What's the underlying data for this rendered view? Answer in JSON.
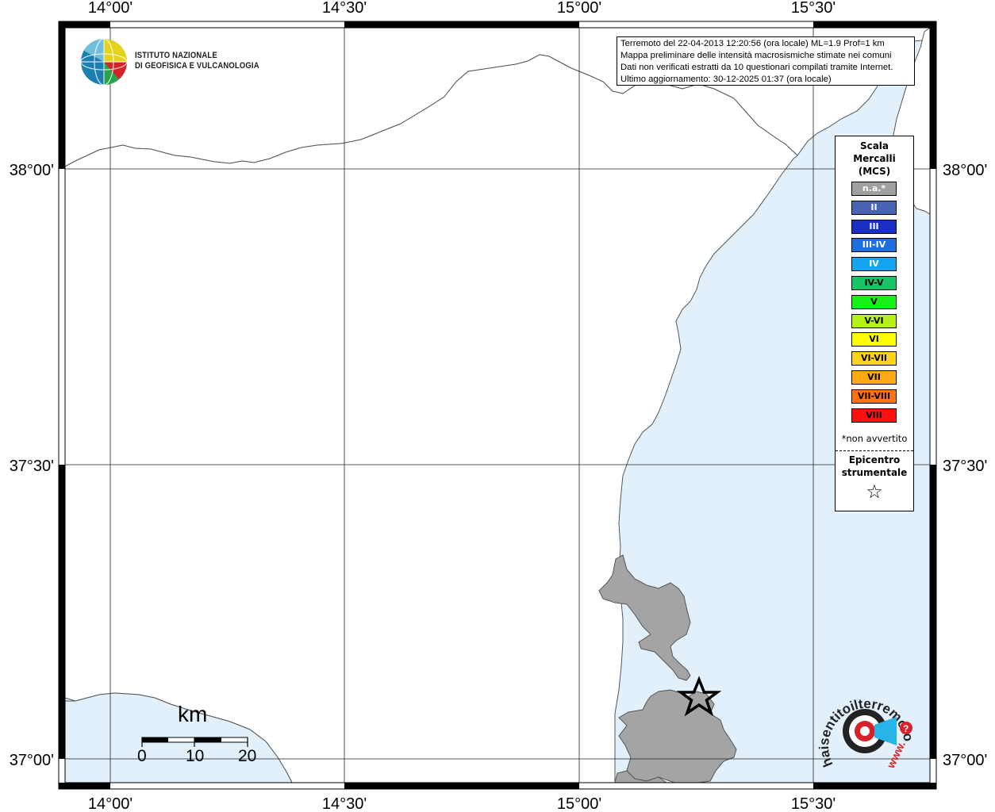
{
  "map": {
    "colors": {
      "sea": "#e1f0fb",
      "land": "#ffffff",
      "island": "#a4a4a4",
      "frame": "#000000"
    },
    "lon_ticks": [
      "14°00'",
      "14°30'",
      "15°00'",
      "15°30'"
    ],
    "lat_ticks": [
      "38°00'",
      "37°30'",
      "37°00'"
    ]
  },
  "info": {
    "line1": "Terremoto del 22-04-2013 12:20:56 (ora locale) ML=1.9 Prof=1 km",
    "line2": "Mappa preliminare delle intensità macrosismiche stimate nei comuni",
    "line3": "Dati non verificati estratti da 10 questionari compilati tramite Internet.",
    "line4": "Ultimo aggiornamento: 30-12-2025 01:37 (ora locale)"
  },
  "logo": {
    "line1": "ISTITUTO NAZIONALE",
    "line2": "DI GEOFISICA E VULCANOLOGIA"
  },
  "legend": {
    "title1": "Scala",
    "title2": "Mercalli",
    "title3": "(MCS)",
    "items": [
      {
        "label": "n.a.*",
        "color": "#a0a0a0"
      },
      {
        "label": "II",
        "color": "#4a64b4"
      },
      {
        "label": "III",
        "color": "#1a2ec4"
      },
      {
        "label": "III-IV",
        "color": "#1e6ede"
      },
      {
        "label": "IV",
        "color": "#14a4f0"
      },
      {
        "label": "IV-V",
        "color": "#18c464"
      },
      {
        "label": "V",
        "color": "#18f018"
      },
      {
        "label": "V-VI",
        "color": "#b4f01a"
      },
      {
        "label": "VI",
        "color": "#ffff00"
      },
      {
        "label": "VI-VII",
        "color": "#ffd21e"
      },
      {
        "label": "VII",
        "color": "#ffaa14"
      },
      {
        "label": "VII-VIII",
        "color": "#ff7210"
      },
      {
        "label": "VIII",
        "color": "#ff1010"
      }
    ],
    "note": "*non avvertito",
    "epicenter1": "Epicentro",
    "epicenter2": "strumentale",
    "star": "☆"
  },
  "scale_bar": {
    "unit": "km",
    "labels": [
      "0",
      "10",
      "20"
    ]
  },
  "haisentito": {
    "text": "haisentitoilterremoto.it",
    "prefix": "www."
  }
}
